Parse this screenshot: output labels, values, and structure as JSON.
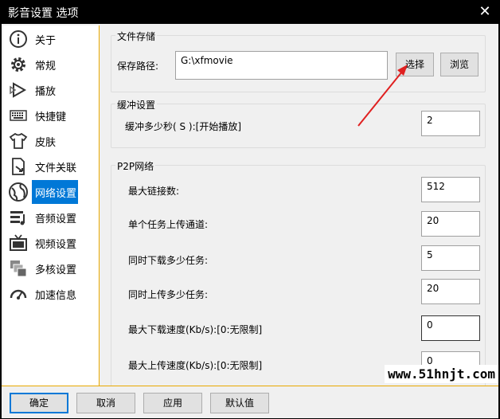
{
  "window": {
    "title": "影音设置 选项",
    "close_glyph": "✕"
  },
  "sidebar": {
    "items": [
      {
        "label": "关于",
        "icon": "info-icon"
      },
      {
        "label": "常规",
        "icon": "gear-icon"
      },
      {
        "label": "播放",
        "icon": "play-icon"
      },
      {
        "label": "快捷键",
        "icon": "keyboard-icon"
      },
      {
        "label": "皮肤",
        "icon": "shirt-icon"
      },
      {
        "label": "文件关联",
        "icon": "file-link-icon"
      },
      {
        "label": "网络设置",
        "icon": "globe-icon",
        "active": true
      },
      {
        "label": "音频设置",
        "icon": "audio-icon"
      },
      {
        "label": "视频设置",
        "icon": "tv-icon"
      },
      {
        "label": "多核设置",
        "icon": "multicore-icon"
      },
      {
        "label": "加速信息",
        "icon": "speed-icon"
      }
    ]
  },
  "storage": {
    "title": "文件存储",
    "path_label": "保存路径:",
    "path_value": "G:\\xfmovie",
    "choose_button": "选择",
    "browse_button": "浏览"
  },
  "buffer": {
    "title": "缓冲设置",
    "seconds_label": "缓冲多少秒( S ):[开始播放]",
    "seconds_value": "2"
  },
  "p2p": {
    "title": "P2P网络",
    "fields": [
      {
        "label": "最大链接数:",
        "value": "512"
      },
      {
        "label": "单个任务上传通道:",
        "value": "20"
      },
      {
        "label": "同时下载多少任务:",
        "value": "5"
      },
      {
        "label": "同时上传多少任务:",
        "value": "20"
      },
      {
        "label": "最大下载速度(Kb/s):[0:无限制]",
        "value": "0"
      },
      {
        "label": "最大上传速度(Kb/s):[0:无限制]",
        "value": "0"
      }
    ]
  },
  "footer": {
    "ok": "确定",
    "cancel": "取消",
    "apply": "应用",
    "default": "默认值"
  },
  "watermark": "www.51hnjt.com",
  "colors": {
    "accent": "#0078d7",
    "divider": "#e8a800",
    "arrow": "#e02020"
  }
}
